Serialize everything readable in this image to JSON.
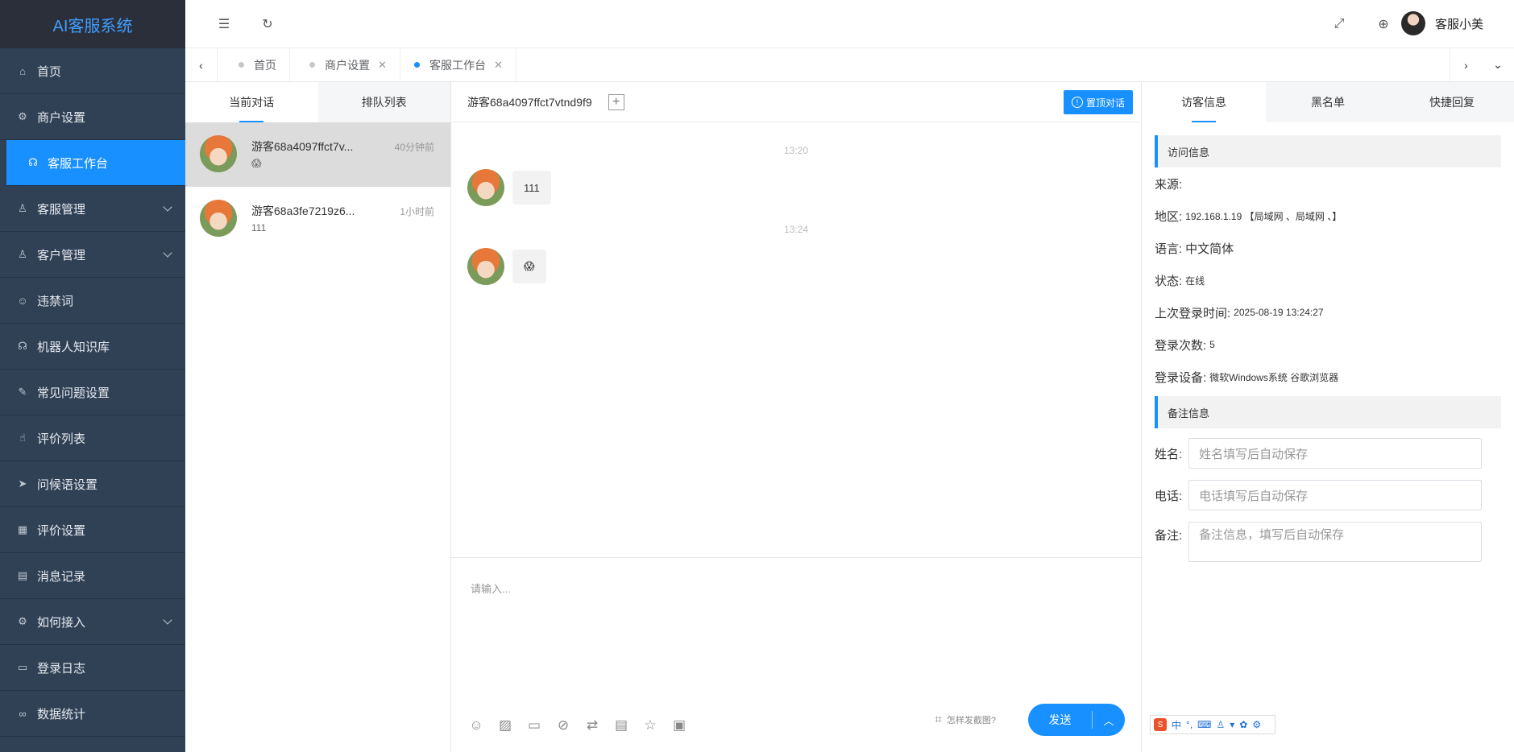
{
  "app": {
    "title": "AI客服系统"
  },
  "sidebar": {
    "items": [
      {
        "label": "首页",
        "icon": "home-icon"
      },
      {
        "label": "商户设置",
        "icon": "gear-icon"
      },
      {
        "label": "客服工作台",
        "icon": "headset-icon",
        "active": true
      },
      {
        "label": "客服管理",
        "icon": "user-icon",
        "expandable": true
      },
      {
        "label": "客户管理",
        "icon": "users-icon",
        "expandable": true
      },
      {
        "label": "违禁词",
        "icon": "smile-icon"
      },
      {
        "label": "机器人知识库",
        "icon": "robot-icon"
      },
      {
        "label": "常见问题设置",
        "icon": "edit-doc-icon"
      },
      {
        "label": "评价列表",
        "icon": "thumbs-up-icon"
      },
      {
        "label": "问候语设置",
        "icon": "send-icon"
      },
      {
        "label": "评价设置",
        "icon": "calendar-icon"
      },
      {
        "label": "消息记录",
        "icon": "document-icon"
      },
      {
        "label": "如何接入",
        "icon": "settings-icon",
        "expandable": true
      },
      {
        "label": "登录日志",
        "icon": "log-icon"
      },
      {
        "label": "数据统计",
        "icon": "link-icon"
      }
    ]
  },
  "topbar": {
    "username": "客服小美"
  },
  "tabs": [
    {
      "label": "首页",
      "closable": false
    },
    {
      "label": "商户设置",
      "closable": true
    },
    {
      "label": "客服工作台",
      "closable": true,
      "active": true
    }
  ],
  "conversations": {
    "tabs": [
      "当前对话",
      "排队列表"
    ],
    "items": [
      {
        "name": "游客68a4097ffct7v...",
        "time": "40分钟前",
        "preview": "😱"
      },
      {
        "name": "游客68a3fe7219z6...",
        "time": "1小时前",
        "preview": "111"
      }
    ]
  },
  "chat": {
    "visitor": "游客68a4097ffct7vtnd9f9",
    "pin_label": "置顶对话",
    "messages": [
      {
        "time": "13:20",
        "text": "111"
      },
      {
        "time": "13:24",
        "text": "😱"
      }
    ],
    "input_placeholder": "请输入...",
    "screenshot_tip": "怎样发截图?",
    "send_label": "发送"
  },
  "info": {
    "tabs": [
      "访客信息",
      "黑名单",
      "快捷回复"
    ],
    "visit_section": "访问信息",
    "source_label": "来源:",
    "region_label": "地区:",
    "region_value": "192.168.1.19 【局域网 、局域网 、】",
    "language_label": "语言:",
    "language_value": "中文简体",
    "status_label": "状态:",
    "status_value": "在线",
    "last_login_label": "上次登录时间:",
    "last_login_value": "2025-08-19 13:24:27",
    "login_count_label": "登录次数:",
    "login_count_value": "5",
    "device_label": "登录设备:",
    "device_value": "微软Windows系统 谷歌浏览器",
    "remark_section": "备注信息",
    "name_label": "姓名:",
    "name_placeholder": "姓名填写后自动保存",
    "phone_label": "电话:",
    "phone_placeholder": "电话填写后自动保存",
    "note_label": "备注:",
    "note_placeholder": "备注信息，填写后自动保存"
  },
  "ime": {
    "mode": "中"
  },
  "colors": {
    "sidebar_bg": "#304156",
    "accent": "#1890ff"
  }
}
